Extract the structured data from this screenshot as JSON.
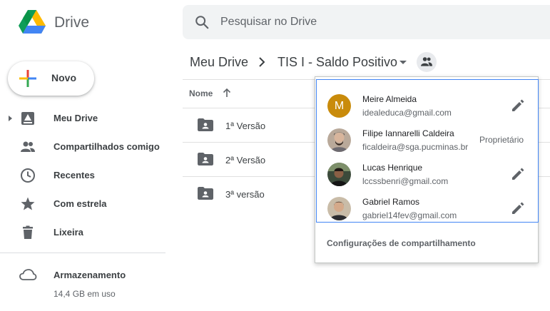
{
  "app": {
    "name": "Drive"
  },
  "search": {
    "placeholder": "Pesquisar no Drive"
  },
  "new_button": {
    "label": "Novo"
  },
  "sidebar": {
    "items": [
      {
        "label": "Meu Drive",
        "icon": "drive-icon"
      },
      {
        "label": "Compartilhados comigo",
        "icon": "people-icon"
      },
      {
        "label": "Recentes",
        "icon": "clock-icon"
      },
      {
        "label": "Com estrela",
        "icon": "star-icon"
      },
      {
        "label": "Lixeira",
        "icon": "trash-icon"
      }
    ],
    "storage": {
      "title": "Armazenamento",
      "used": "14,4 GB em uso"
    }
  },
  "breadcrumb": {
    "root": "Meu Drive",
    "current": "TIS I - Saldo Positivo"
  },
  "list": {
    "column_name": "Nome",
    "files": [
      {
        "name": "1ª Versão"
      },
      {
        "name": "2ª Versão"
      },
      {
        "name": "3ª versão"
      }
    ]
  },
  "sharing": {
    "people": [
      {
        "initial": "M",
        "name": "Meire Almeida",
        "email": "idealeduca@gmail.com",
        "role": ""
      },
      {
        "initial": "",
        "name": "Filipe Iannarelli Caldeira",
        "email": "ficaldeira@sga.pucminas.br",
        "role": "Proprietário"
      },
      {
        "initial": "",
        "name": "Lucas Henrique",
        "email": "lccssbenri@gmail.com",
        "role": ""
      },
      {
        "initial": "",
        "name": "Gabriel Ramos",
        "email": "gabriel14fev@gmail.com",
        "role": ""
      }
    ],
    "settings_link": "Configurações de compartilhamento"
  },
  "colors": {
    "accent_blue": "#4285f4",
    "avatar_orange": "#c98b0b",
    "icon_grey": "#5f6368"
  }
}
